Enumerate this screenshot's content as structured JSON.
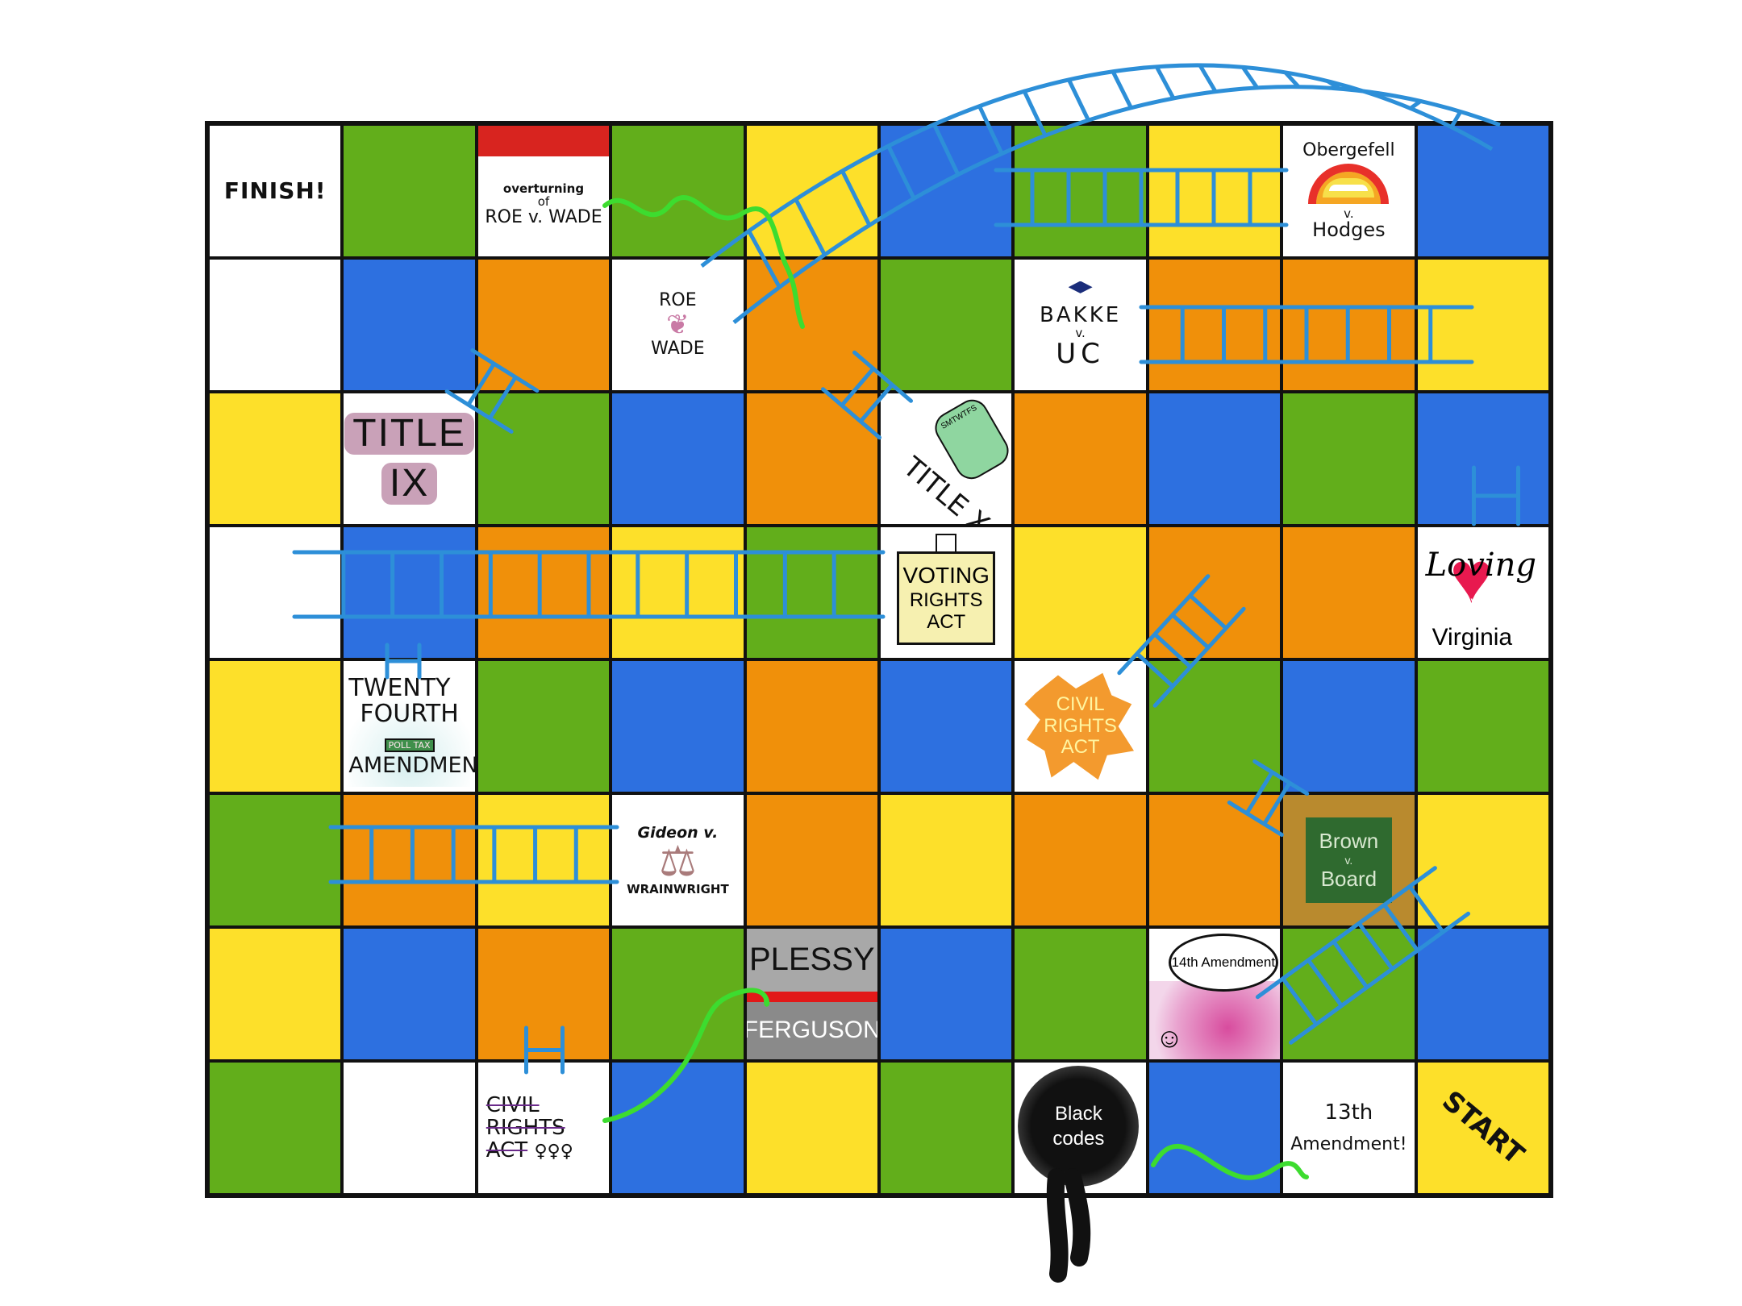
{
  "board": {
    "rows": [
      [
        "w",
        "g",
        "w",
        "g",
        "y",
        "b",
        "g",
        "y",
        "w",
        "b"
      ],
      [
        "w",
        "b",
        "o",
        "w",
        "o",
        "g",
        "w",
        "o",
        "o",
        "y"
      ],
      [
        "y",
        "w",
        "g",
        "b",
        "o",
        "w",
        "o",
        "b",
        "g",
        "b"
      ],
      [
        "w",
        "b",
        "o",
        "y",
        "g",
        "w",
        "y",
        "o",
        "o",
        "w"
      ],
      [
        "y",
        "w",
        "g",
        "b",
        "o",
        "b",
        "w",
        "g",
        "b",
        "g"
      ],
      [
        "g",
        "o",
        "y",
        "w",
        "o",
        "y",
        "o",
        "o",
        "w",
        "y"
      ],
      [
        "y",
        "b",
        "o",
        "g",
        "w",
        "b",
        "g",
        "w",
        "g",
        "b"
      ],
      [
        "g",
        "w",
        "w",
        "b",
        "y",
        "g",
        "w",
        "b",
        "w",
        "y"
      ]
    ],
    "colors": {
      "g": "#62ae1b",
      "b": "#2d70e0",
      "y": "#fde02a",
      "o": "#f0900a",
      "w": "#ffffff"
    }
  },
  "squares": {
    "finish": "FINISH!",
    "start": "START",
    "overturning": {
      "line1": "overturning",
      "line2": "of",
      "line3": "ROE v. WADE"
    },
    "obergefell": {
      "line1": "Obergefell",
      "v": "v.",
      "line2": "Hodges"
    },
    "roe_wade": {
      "line1": "ROE",
      "line2": "WADE"
    },
    "bakke": {
      "line1": "BAKKE",
      "v": "v.",
      "line2": "UC"
    },
    "title_ix": {
      "line1": "TITLE",
      "line2": "IX"
    },
    "title_x": {
      "text": "TITLE X",
      "pill": "SMTWTFS"
    },
    "voting": {
      "line1": "VOTING",
      "line2": "RIGHTS",
      "line3": "ACT"
    },
    "loving": {
      "line1": "Loving",
      "v": "v.",
      "line2": "Virginia"
    },
    "twenty_fourth": {
      "line1": "TWENTY",
      "line2": "FOURTH",
      "line3": "AMENDMENT",
      "stamp": "POLL TAX"
    },
    "civil_rights_1964": {
      "line1": "CIVIL",
      "line2": "RIGHTS",
      "line3": "ACT"
    },
    "gideon": {
      "line1": "Gideon v.",
      "line2": "WRAINWRIGHT"
    },
    "brown": {
      "line1": "Brown",
      "v": "v.",
      "line2": "Board"
    },
    "plessy": {
      "line1": "PLESSY",
      "line2": "FERGUSON"
    },
    "fourteenth": {
      "text": "14th Amendment"
    },
    "civil_rights_1875": {
      "line1": "CIVIL",
      "line2": "RIGHTS",
      "line3": "ACT",
      "symbols": "♀♀♀"
    },
    "black_codes": {
      "line1": "Black",
      "line2": "codes"
    },
    "thirteenth": {
      "line1": "13th",
      "line2": "Amendment!"
    }
  },
  "ladder_color": "#2d8fd8",
  "snake_color": "#3ddc2f"
}
